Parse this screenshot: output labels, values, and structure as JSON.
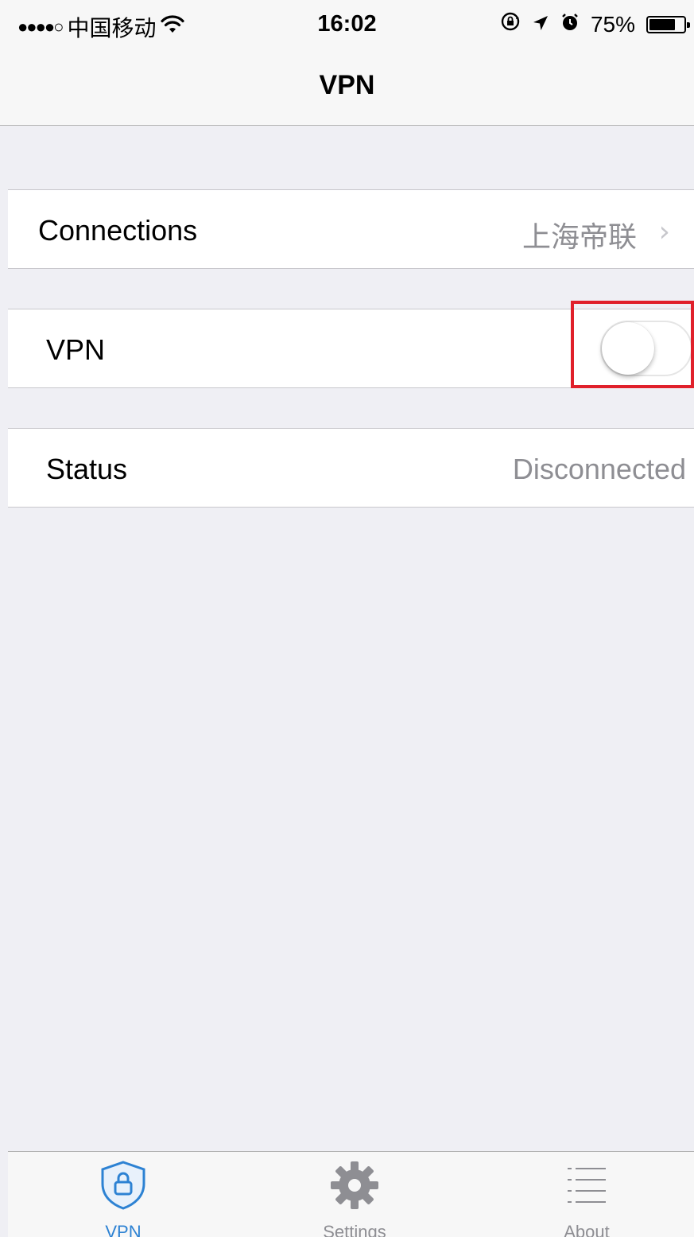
{
  "status_bar": {
    "signal": "●●●●○",
    "carrier": "中国移动",
    "time": "16:02",
    "battery_percent_text": "75%",
    "battery_level": 0.75,
    "icons": [
      "wifi-icon",
      "rotation-lock-icon",
      "location-arrow-icon",
      "alarm-icon",
      "battery-icon"
    ]
  },
  "nav": {
    "title": "VPN"
  },
  "rows": {
    "connections": {
      "label": "Connections",
      "value": "上海帝联"
    },
    "vpn": {
      "label": "VPN",
      "toggle_on": false
    },
    "status": {
      "label": "Status",
      "value": "Disconnected"
    }
  },
  "tabs": [
    {
      "label": "VPN",
      "icon": "shield-lock-icon",
      "active": true
    },
    {
      "label": "Settings",
      "icon": "gear-icon",
      "active": false
    },
    {
      "label": "About",
      "icon": "list-icon",
      "active": false
    }
  ],
  "colors": {
    "accent": "#2d82d3",
    "highlight": "#e0202b",
    "background": "#efeff4",
    "secondary_text": "#8e8e93"
  }
}
